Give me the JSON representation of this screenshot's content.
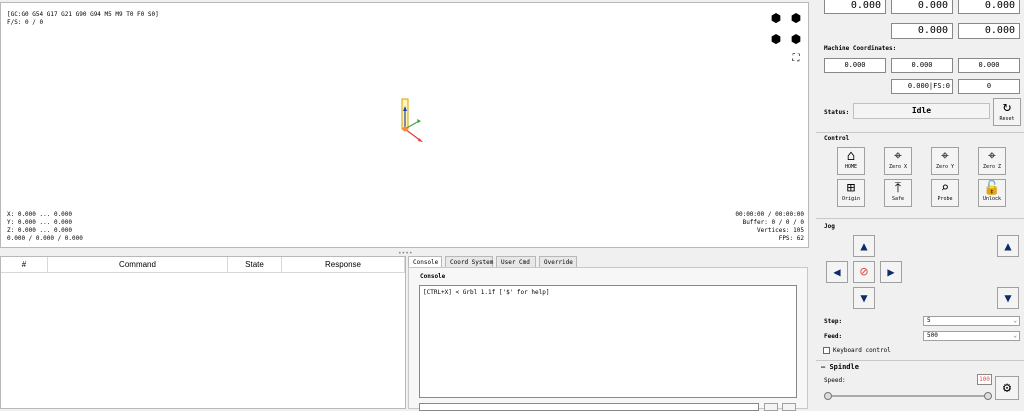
{
  "visualizer": {
    "gcode_state": "[GC:G0 G54 G17 G21 G90 G94 M5 M9 T0 F0 S0]",
    "fs_line": "F/S: 0 / 0",
    "x_range": "X: 0.000 ... 0.000",
    "y_range": "Y: 0.000 ... 0.000",
    "z_range": "Z: 0.000 ... 0.000",
    "size_line": "0.000 / 0.000 / 0.000",
    "time": "00:00:00 / 00:00:00",
    "buffer": "Buffer: 0 / 0 / 0",
    "vertices": "Vertices: 105",
    "fps": "FPS: 62"
  },
  "table": {
    "columns": [
      "#",
      "Command",
      "State",
      "Response"
    ]
  },
  "tabs": [
    "Console",
    "Coord System",
    "User Cmd",
    "Override"
  ],
  "console": {
    "title": "Console",
    "lines": [
      "[CTRL+X] < Grbl 1.1f ['$' for help]"
    ]
  },
  "work_coords": {
    "row1": [
      "0.000",
      "0.000",
      "0.000"
    ],
    "row2": [
      "0.000",
      "0.000"
    ]
  },
  "machine": {
    "label": "Machine Coordinates:",
    "row1": [
      "0.000",
      "0.000",
      "0.000"
    ],
    "fs_value": "0.000",
    "fs_label": "FS:0",
    "last": "0"
  },
  "status": {
    "label": "Status:",
    "value": "Idle",
    "reset_label": "Reset"
  },
  "control": {
    "title": "Control",
    "buttons": [
      {
        "label": "HOME",
        "icon": "⌂"
      },
      {
        "label": "Zero X",
        "icon": "⌖"
      },
      {
        "label": "Zero Y",
        "icon": "⌖"
      },
      {
        "label": "Zero Z",
        "icon": "⌖"
      },
      {
        "label": "Origin",
        "icon": "⊞"
      },
      {
        "label": "Safe",
        "icon": "⤒"
      },
      {
        "label": "Probe",
        "icon": "⌕"
      },
      {
        "label": "Unlock",
        "icon": "🔓"
      }
    ]
  },
  "jog": {
    "title": "Jog",
    "step_label": "Step:",
    "step_value": "5",
    "feed_label": "Feed:",
    "feed_value": "500",
    "keyboard_label": "Keyboard control"
  },
  "spindle": {
    "title": "Spindle",
    "speed_label": "Speed:",
    "speed_value": "100",
    "slider_fraction": 1.0
  },
  "colors": {
    "accent_red": "#d9534f",
    "jog_arrow": "#0b2d6b",
    "axis_x": "#e53935",
    "axis_y": "#43a047",
    "axis_z": "#1e40c8"
  }
}
